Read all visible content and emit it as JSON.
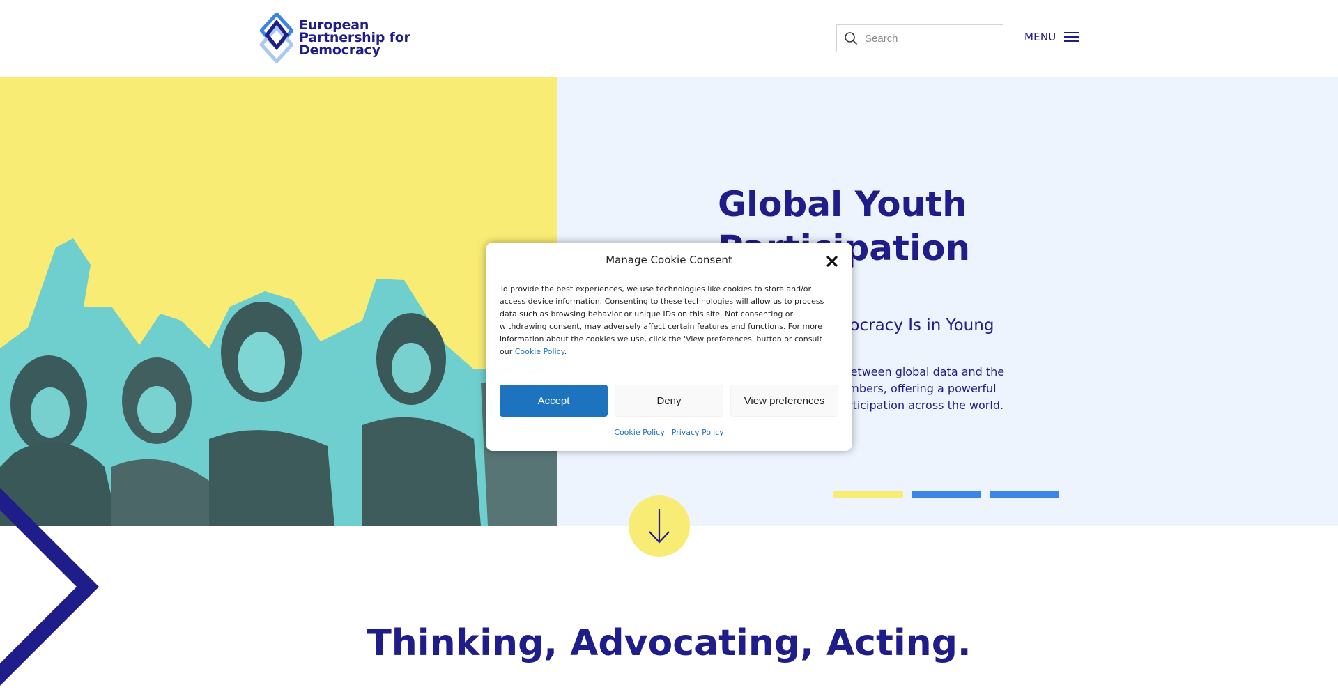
{
  "header": {
    "logo_lines": [
      "European",
      "Partnership for",
      "Democracy"
    ],
    "search_placeholder": "Search",
    "menu_label": "MENU"
  },
  "hero": {
    "title": "Global Youth Participation",
    "subtitle_visible": "mocracy Is in Young",
    "text_visible_lines": [
      "s between global data and the",
      "numbers, offering a powerful",
      "participation across the world."
    ],
    "slider": {
      "count": 3,
      "active_index": 0
    }
  },
  "section": {
    "title": "Thinking, Advocating, Acting."
  },
  "cookie": {
    "title": "Manage Cookie Consent",
    "body": "To provide the best experiences, we use technologies like cookies to store and/or access device information. Consenting to these technologies will allow us to process data such as browsing behavior or unique IDs on this site. Not consenting or withdrawing consent, may adversely affect certain features and functions. For more information about the cookies we use, click the 'View preferences' button or consult our",
    "body_link": "Cookie Policy",
    "body_end": ".",
    "accept_label": "Accept",
    "deny_label": "Deny",
    "view_label": "View preferences",
    "footer_links": [
      "Cookie Policy",
      "Privacy Policy"
    ]
  },
  "colors": {
    "navy": "#1f1d8a",
    "yellow": "#f9ec74",
    "light_blue_bg": "#eef4fd",
    "blue": "#3a86e6",
    "accept_blue": "#1e73be",
    "photo_cyan": "#6fcfcf"
  },
  "icons": {
    "search": "search-icon",
    "menu": "hamburger-icon",
    "close": "close-icon",
    "scroll": "arrow-down-icon"
  }
}
